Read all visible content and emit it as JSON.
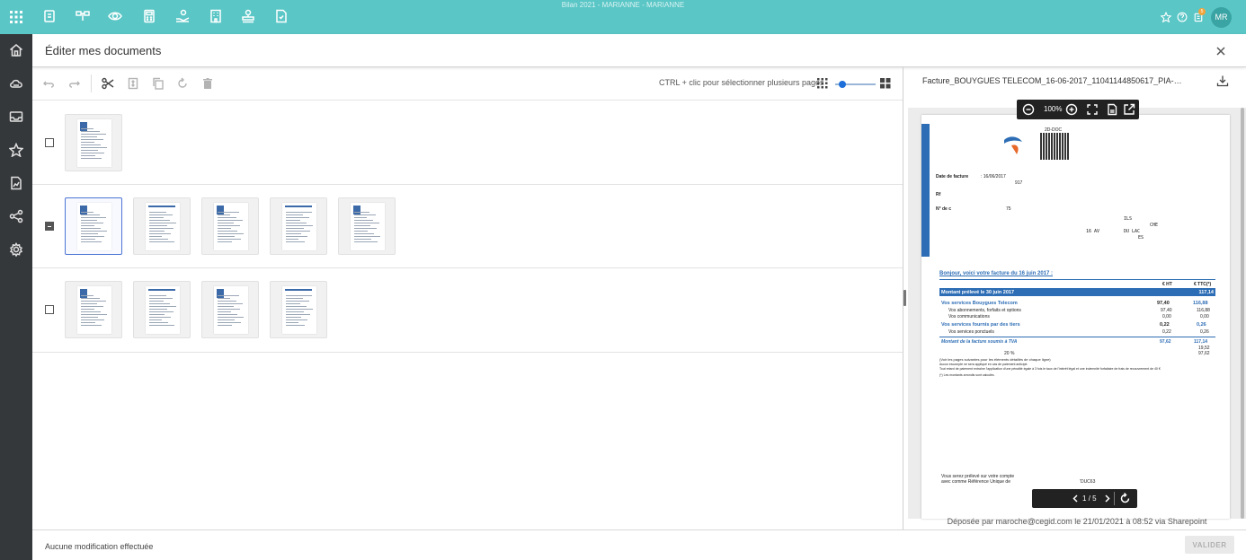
{
  "topbar": {
    "title": "Bilan 2021 - MARIANNE - MARIANNE",
    "avatar_initials": "MR",
    "notification_count": "5",
    "modules": [
      "document-icon",
      "org-chart-icon",
      "eye-icon",
      "calculator-icon",
      "hand-coins-icon",
      "building-icon",
      "stamp-icon",
      "file-check-icon"
    ]
  },
  "sidebar": {
    "items": [
      "home-icon",
      "cloud-icon",
      "inbox-icon",
      "star-icon",
      "chart-file-icon",
      "share-icon",
      "settings-icon"
    ]
  },
  "panel": {
    "title": "Éditer mes documents"
  },
  "toolbar": {
    "hint": "CTRL + clic pour sélectionner plusieurs pages",
    "zoom_fraction": 0.1
  },
  "documents": [
    {
      "checkbox": "unchecked",
      "pages": 1,
      "selected_page": null
    },
    {
      "checkbox": "indeterminate",
      "pages": 5,
      "selected_page": 0
    },
    {
      "checkbox": "unchecked",
      "pages": 4,
      "selected_page": null
    }
  ],
  "viewer": {
    "filename": "Facture_BOUYGUES TELECOM_16-06-2017_11041144850617_PIA-1611219...",
    "zoom": "100%",
    "page_current": "1",
    "page_total": "5",
    "page_separator": "/",
    "deposited": "Déposée par maroche@cegid.com le 21/01/2021 à 08:52 via Sharepoint"
  },
  "invoice": {
    "code_label": "2D-DOC",
    "date_label": "Date de facture",
    "date_value": ": 16/06/2017",
    "line_917": "917",
    "ref_label": "Rf",
    "num_label": "N° de c",
    "num_value": "75",
    "addr1": "ILS",
    "addr2": "CHE",
    "addr3": "16 AV",
    "addr4": "DU LAC",
    "addr5": "ES",
    "greeting": "Bonjour, voici votre facture du 16 juin 2017 :",
    "col_ht": "€ HT",
    "col_ttc": "€ TTC(*)",
    "montant_label": "Montant prélevé le 30 juin 2017",
    "montant_value": "117,14",
    "svc_bt_label": "Vos services Bouygues Telecom",
    "svc_bt_ht": "97,40",
    "svc_bt_ttc": "116,88",
    "svc1_label": "Vos abonnements, forfaits et options",
    "svc1_ht": "97,40",
    "svc1_ttc": "116,88",
    "svc2_label": "Vos communications",
    "svc2_ht": "0,00",
    "svc2_ttc": "0,00",
    "svc_tiers_label": "Vos services fournis par des tiers",
    "svc_tiers_ht": "0,22",
    "svc_tiers_ttc": "0,26",
    "svc3_label": "Vos services ponctuels",
    "svc3_ht": "0,22",
    "svc3_ttc": "0,26",
    "tva_label": "Montant de la facture soumis à TVA",
    "tva_ht": "97,62",
    "tva_ttc": "117,14",
    "tva_sub1": "19,52",
    "tva_sub2": "97,62",
    "tva_rate": "20 %",
    "note1": "(Voir les pages suivantes pour les éléments détaillés de chaque ligne)",
    "note2": "Aucun escompte ne sera appliqué en cas de paiement anticipé.",
    "note3": "Tout retard de paiement entraîne l'application d'une pénalité égale à 3 fois le taux de l'intérêt légal et une indemnité forfaitaire de frais de recouvrement de 40 €",
    "note4": "(*) Les montants arrondis sont calculés.",
    "footer1": "Vous serez prélevé sur votre compte",
    "footer2": "avec comme Référence Unique de",
    "footer_ref": "'DUC63"
  },
  "footer": {
    "status": "Aucune modification effectuée",
    "validate_label": "VALIDER"
  },
  "colors": {
    "topbar": "#5bc6c6",
    "sidebar": "#35383b",
    "accent": "#1e6fd9",
    "invoice_blue": "#2d6db5"
  }
}
